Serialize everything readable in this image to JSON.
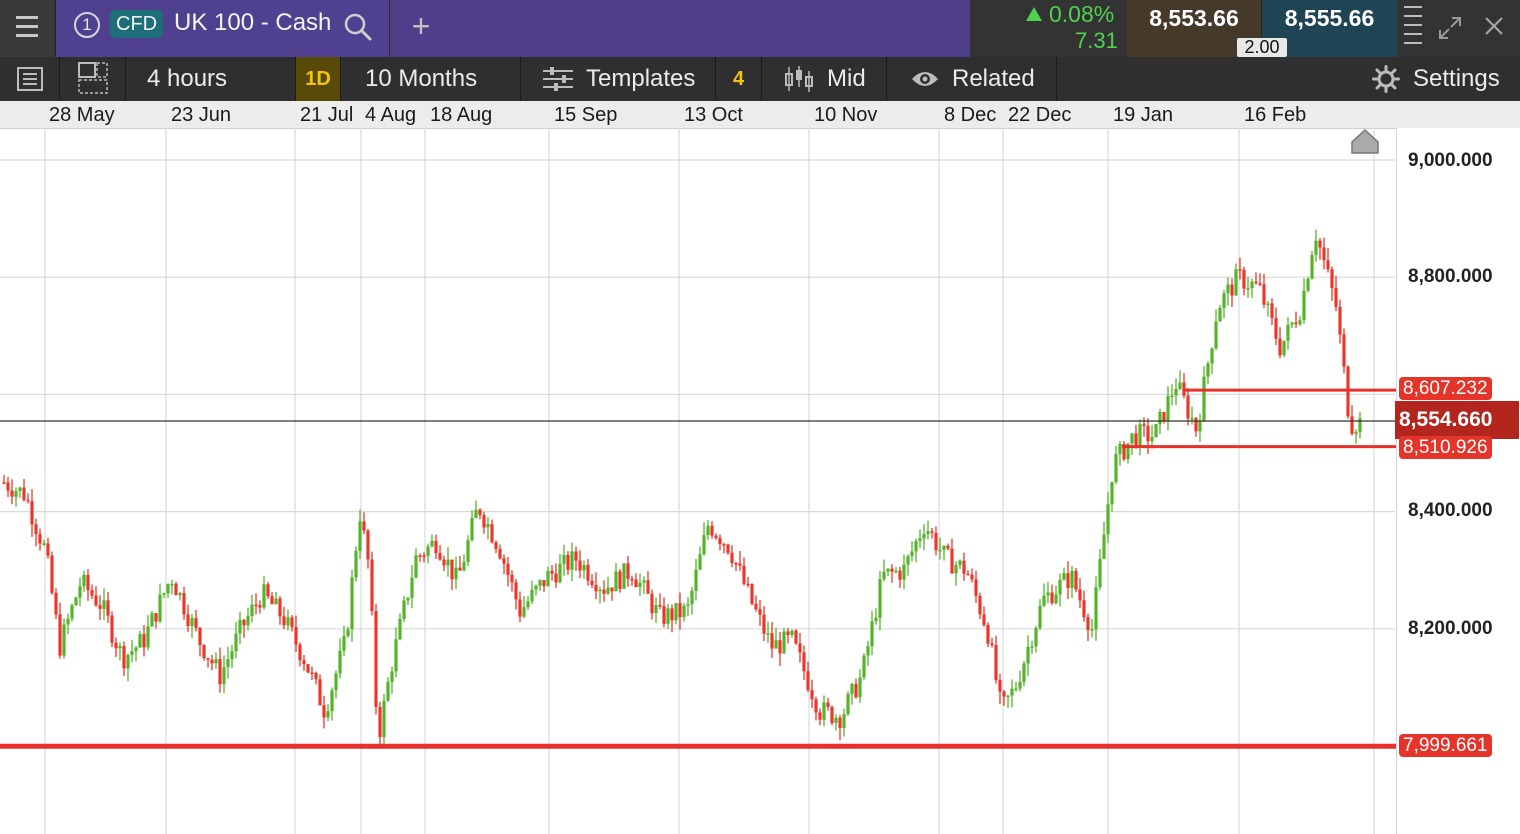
{
  "header": {
    "instrument_number": "1",
    "instrument_type": "CFD",
    "instrument_name": "UK 100 - Cash",
    "change_percent": "0.08%",
    "change_points": "7.31",
    "sell_price": "8,553.66",
    "buy_price": "8,555.66",
    "spread": "2.00",
    "icons": [
      "menu-icon",
      "search-icon",
      "plus-icon",
      "up-triangle-icon",
      "expand-icon",
      "close-icon"
    ]
  },
  "toolbar": {
    "interval": "4 hours",
    "timeframe_badge": "1D",
    "range": "10 Months",
    "templates": "Templates",
    "templates_count": "4",
    "price_mode": "Mid",
    "related": "Related",
    "settings": "Settings",
    "icons": [
      "list-icon",
      "layout-icon",
      "templates-sliders-icon",
      "candlestick-icon",
      "eye-icon",
      "gear-icon"
    ]
  },
  "date_axis": [
    "28 May",
    "23 Jun",
    "21 Jul",
    "4 Aug",
    "18 Aug",
    "15 Sep",
    "13 Oct",
    "10 Nov",
    "8 Dec",
    "22 Dec",
    "19 Jan",
    "16 Feb"
  ],
  "price_axis": [
    "9,000.000",
    "8,800.000",
    "8,400.000",
    "8,200.000"
  ],
  "levels": {
    "upper_line": "8,607.232",
    "current": "8,554.660",
    "lower_line": "8,510.926",
    "support_line": "7,999.661"
  },
  "chart_data": {
    "type": "candlestick",
    "title": "",
    "xlabel": "",
    "ylabel": "",
    "ylim": [
      7930,
      9050
    ],
    "candle_interval": "4 hours",
    "up_color": "#55b52a",
    "down_color": "#e8382c",
    "horizontal_lines": [
      8607.232,
      8510.926,
      7999.661
    ],
    "current_price": 8554.66,
    "x": [
      "28 May",
      "23 Jun",
      "21 Jul",
      "4 Aug",
      "18 Aug",
      "15 Sep",
      "13 Oct",
      "10 Nov",
      "8 Dec",
      "22 Dec",
      "19 Jan",
      "16 Feb"
    ],
    "approx_close_path": [
      [
        0,
        8450
      ],
      [
        0.015,
        8430
      ],
      [
        0.03,
        8330
      ],
      [
        0.04,
        8170
      ],
      [
        0.055,
        8280
      ],
      [
        0.07,
        8240
      ],
      [
        0.085,
        8150
      ],
      [
        0.1,
        8180
      ],
      [
        0.12,
        8290
      ],
      [
        0.14,
        8180
      ],
      [
        0.155,
        8120
      ],
      [
        0.17,
        8200
      ],
      [
        0.185,
        8260
      ],
      [
        0.2,
        8220
      ],
      [
        0.215,
        8150
      ],
      [
        0.23,
        8060
      ],
      [
        0.245,
        8180
      ],
      [
        0.255,
        8400
      ],
      [
        0.262,
        8300
      ],
      [
        0.268,
        8010
      ],
      [
        0.278,
        8140
      ],
      [
        0.295,
        8320
      ],
      [
        0.31,
        8350
      ],
      [
        0.325,
        8280
      ],
      [
        0.34,
        8410
      ],
      [
        0.355,
        8340
      ],
      [
        0.37,
        8230
      ],
      [
        0.39,
        8290
      ],
      [
        0.41,
        8320
      ],
      [
        0.43,
        8270
      ],
      [
        0.45,
        8300
      ],
      [
        0.47,
        8220
      ],
      [
        0.49,
        8230
      ],
      [
        0.505,
        8380
      ],
      [
        0.52,
        8340
      ],
      [
        0.535,
        8250
      ],
      [
        0.55,
        8170
      ],
      [
        0.565,
        8180
      ],
      [
        0.585,
        8060
      ],
      [
        0.6,
        8050
      ],
      [
        0.615,
        8120
      ],
      [
        0.63,
        8290
      ],
      [
        0.645,
        8300
      ],
      [
        0.66,
        8380
      ],
      [
        0.675,
        8320
      ],
      [
        0.69,
        8300
      ],
      [
        0.705,
        8200
      ],
      [
        0.715,
        8060
      ],
      [
        0.725,
        8100
      ],
      [
        0.745,
        8250
      ],
      [
        0.765,
        8290
      ],
      [
        0.78,
        8200
      ],
      [
        0.795,
        8480
      ],
      [
        0.81,
        8530
      ],
      [
        0.825,
        8530
      ],
      [
        0.84,
        8620
      ],
      [
        0.855,
        8540
      ],
      [
        0.87,
        8750
      ],
      [
        0.885,
        8800
      ],
      [
        0.9,
        8780
      ],
      [
        0.915,
        8680
      ],
      [
        0.93,
        8750
      ],
      [
        0.94,
        8880
      ],
      [
        0.955,
        8750
      ],
      [
        0.965,
        8550
      ],
      [
        0.975,
        8554
      ]
    ]
  }
}
